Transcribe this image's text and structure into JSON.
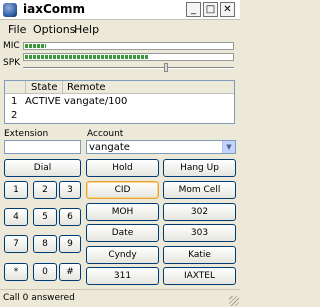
{
  "window": {
    "title": "iaxComm",
    "controls": {
      "minimize": "_",
      "maximize": "□",
      "close": "✕"
    }
  },
  "menu": {
    "items": [
      "File",
      "Options",
      "Help"
    ]
  },
  "meters": {
    "mic_label": "MIC",
    "spk_label": "SPK",
    "mic_level": 0.1,
    "spk_level": 0.6,
    "spk_volume": 0.68
  },
  "calls": {
    "headers": [
      "State",
      "Remote"
    ],
    "rows": [
      {
        "num": "1",
        "state": "ACTIVE",
        "remote": "vangate/100"
      },
      {
        "num": "2",
        "state": "",
        "remote": ""
      }
    ]
  },
  "extension": {
    "label": "Extension",
    "value": ""
  },
  "account": {
    "label": "Account",
    "value": "vangate"
  },
  "buttons": {
    "dial": "Dial",
    "hold": "Hold",
    "hangup": "Hang Up",
    "keypad": [
      "1",
      "2",
      "3",
      "4",
      "5",
      "6",
      "7",
      "8",
      "9",
      "*",
      "0",
      "#"
    ],
    "speed": [
      "CID",
      "Mom Cell",
      "MOH",
      "302",
      "Date",
      "303",
      "Cyndy",
      "Katie",
      "311",
      "IAXTEL"
    ]
  },
  "status": {
    "text": "Call 0 answered"
  }
}
